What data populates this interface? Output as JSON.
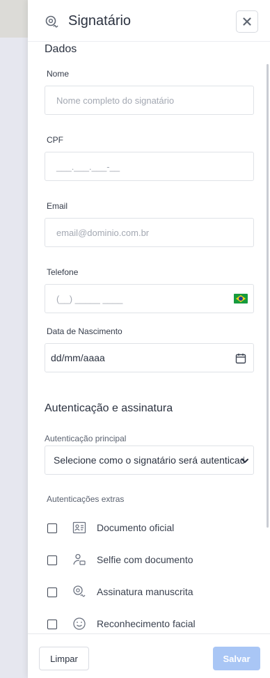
{
  "header": {
    "title": "Signatário"
  },
  "dados": {
    "section_title": "Dados",
    "fields": {
      "nome": {
        "label": "Nome",
        "placeholder": "Nome completo do signatário"
      },
      "cpf": {
        "label": "CPF",
        "placeholder": "___.___.___-__"
      },
      "email": {
        "label": "Email",
        "placeholder": "email@dominio.com.br"
      },
      "telefone": {
        "label": "Telefone",
        "placeholder": "(__) _____ ____"
      },
      "nascimento": {
        "label": "Data de Nascimento",
        "value": "dd/mm/aaaa"
      }
    }
  },
  "autenticacao": {
    "section_title": "Autenticação e assinatura",
    "principal_label": "Autenticação principal",
    "principal_selected": "Selecione como o signatário será autenticado",
    "extras_label": "Autenticações extras",
    "extras": [
      {
        "label": "Documento oficial",
        "icon": "id-card-icon",
        "checked": false
      },
      {
        "label": "Selfie com documento",
        "icon": "user-doc-icon",
        "checked": false
      },
      {
        "label": "Assinatura manuscrita",
        "icon": "signature-badge-icon",
        "checked": false
      },
      {
        "label": "Reconhecimento facial",
        "icon": "smiley-face-icon",
        "checked": false
      }
    ]
  },
  "footer": {
    "clear_label": "Limpar",
    "save_label": "Salvar"
  },
  "colors": {
    "save_disabled": "#a9c6f5",
    "brazil_green": "#169b3e",
    "brazil_yellow": "#f7d617",
    "brazil_blue": "#1f3f97"
  }
}
